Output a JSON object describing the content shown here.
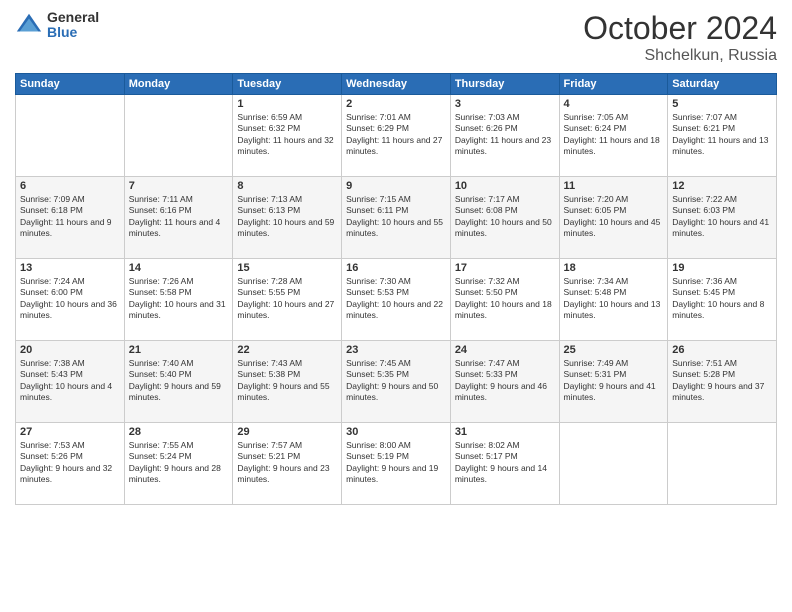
{
  "logo": {
    "general": "General",
    "blue": "Blue"
  },
  "title": {
    "month": "October 2024",
    "location": "Shchelkun, Russia"
  },
  "days_header": [
    "Sunday",
    "Monday",
    "Tuesday",
    "Wednesday",
    "Thursday",
    "Friday",
    "Saturday"
  ],
  "weeks": [
    [
      {
        "day": "",
        "sunrise": "",
        "sunset": "",
        "daylight": ""
      },
      {
        "day": "",
        "sunrise": "",
        "sunset": "",
        "daylight": ""
      },
      {
        "day": "1",
        "sunrise": "Sunrise: 6:59 AM",
        "sunset": "Sunset: 6:32 PM",
        "daylight": "Daylight: 11 hours and 32 minutes."
      },
      {
        "day": "2",
        "sunrise": "Sunrise: 7:01 AM",
        "sunset": "Sunset: 6:29 PM",
        "daylight": "Daylight: 11 hours and 27 minutes."
      },
      {
        "day": "3",
        "sunrise": "Sunrise: 7:03 AM",
        "sunset": "Sunset: 6:26 PM",
        "daylight": "Daylight: 11 hours and 23 minutes."
      },
      {
        "day": "4",
        "sunrise": "Sunrise: 7:05 AM",
        "sunset": "Sunset: 6:24 PM",
        "daylight": "Daylight: 11 hours and 18 minutes."
      },
      {
        "day": "5",
        "sunrise": "Sunrise: 7:07 AM",
        "sunset": "Sunset: 6:21 PM",
        "daylight": "Daylight: 11 hours and 13 minutes."
      }
    ],
    [
      {
        "day": "6",
        "sunrise": "Sunrise: 7:09 AM",
        "sunset": "Sunset: 6:18 PM",
        "daylight": "Daylight: 11 hours and 9 minutes."
      },
      {
        "day": "7",
        "sunrise": "Sunrise: 7:11 AM",
        "sunset": "Sunset: 6:16 PM",
        "daylight": "Daylight: 11 hours and 4 minutes."
      },
      {
        "day": "8",
        "sunrise": "Sunrise: 7:13 AM",
        "sunset": "Sunset: 6:13 PM",
        "daylight": "Daylight: 10 hours and 59 minutes."
      },
      {
        "day": "9",
        "sunrise": "Sunrise: 7:15 AM",
        "sunset": "Sunset: 6:11 PM",
        "daylight": "Daylight: 10 hours and 55 minutes."
      },
      {
        "day": "10",
        "sunrise": "Sunrise: 7:17 AM",
        "sunset": "Sunset: 6:08 PM",
        "daylight": "Daylight: 10 hours and 50 minutes."
      },
      {
        "day": "11",
        "sunrise": "Sunrise: 7:20 AM",
        "sunset": "Sunset: 6:05 PM",
        "daylight": "Daylight: 10 hours and 45 minutes."
      },
      {
        "day": "12",
        "sunrise": "Sunrise: 7:22 AM",
        "sunset": "Sunset: 6:03 PM",
        "daylight": "Daylight: 10 hours and 41 minutes."
      }
    ],
    [
      {
        "day": "13",
        "sunrise": "Sunrise: 7:24 AM",
        "sunset": "Sunset: 6:00 PM",
        "daylight": "Daylight: 10 hours and 36 minutes."
      },
      {
        "day": "14",
        "sunrise": "Sunrise: 7:26 AM",
        "sunset": "Sunset: 5:58 PM",
        "daylight": "Daylight: 10 hours and 31 minutes."
      },
      {
        "day": "15",
        "sunrise": "Sunrise: 7:28 AM",
        "sunset": "Sunset: 5:55 PM",
        "daylight": "Daylight: 10 hours and 27 minutes."
      },
      {
        "day": "16",
        "sunrise": "Sunrise: 7:30 AM",
        "sunset": "Sunset: 5:53 PM",
        "daylight": "Daylight: 10 hours and 22 minutes."
      },
      {
        "day": "17",
        "sunrise": "Sunrise: 7:32 AM",
        "sunset": "Sunset: 5:50 PM",
        "daylight": "Daylight: 10 hours and 18 minutes."
      },
      {
        "day": "18",
        "sunrise": "Sunrise: 7:34 AM",
        "sunset": "Sunset: 5:48 PM",
        "daylight": "Daylight: 10 hours and 13 minutes."
      },
      {
        "day": "19",
        "sunrise": "Sunrise: 7:36 AM",
        "sunset": "Sunset: 5:45 PM",
        "daylight": "Daylight: 10 hours and 8 minutes."
      }
    ],
    [
      {
        "day": "20",
        "sunrise": "Sunrise: 7:38 AM",
        "sunset": "Sunset: 5:43 PM",
        "daylight": "Daylight: 10 hours and 4 minutes."
      },
      {
        "day": "21",
        "sunrise": "Sunrise: 7:40 AM",
        "sunset": "Sunset: 5:40 PM",
        "daylight": "Daylight: 9 hours and 59 minutes."
      },
      {
        "day": "22",
        "sunrise": "Sunrise: 7:43 AM",
        "sunset": "Sunset: 5:38 PM",
        "daylight": "Daylight: 9 hours and 55 minutes."
      },
      {
        "day": "23",
        "sunrise": "Sunrise: 7:45 AM",
        "sunset": "Sunset: 5:35 PM",
        "daylight": "Daylight: 9 hours and 50 minutes."
      },
      {
        "day": "24",
        "sunrise": "Sunrise: 7:47 AM",
        "sunset": "Sunset: 5:33 PM",
        "daylight": "Daylight: 9 hours and 46 minutes."
      },
      {
        "day": "25",
        "sunrise": "Sunrise: 7:49 AM",
        "sunset": "Sunset: 5:31 PM",
        "daylight": "Daylight: 9 hours and 41 minutes."
      },
      {
        "day": "26",
        "sunrise": "Sunrise: 7:51 AM",
        "sunset": "Sunset: 5:28 PM",
        "daylight": "Daylight: 9 hours and 37 minutes."
      }
    ],
    [
      {
        "day": "27",
        "sunrise": "Sunrise: 7:53 AM",
        "sunset": "Sunset: 5:26 PM",
        "daylight": "Daylight: 9 hours and 32 minutes."
      },
      {
        "day": "28",
        "sunrise": "Sunrise: 7:55 AM",
        "sunset": "Sunset: 5:24 PM",
        "daylight": "Daylight: 9 hours and 28 minutes."
      },
      {
        "day": "29",
        "sunrise": "Sunrise: 7:57 AM",
        "sunset": "Sunset: 5:21 PM",
        "daylight": "Daylight: 9 hours and 23 minutes."
      },
      {
        "day": "30",
        "sunrise": "Sunrise: 8:00 AM",
        "sunset": "Sunset: 5:19 PM",
        "daylight": "Daylight: 9 hours and 19 minutes."
      },
      {
        "day": "31",
        "sunrise": "Sunrise: 8:02 AM",
        "sunset": "Sunset: 5:17 PM",
        "daylight": "Daylight: 9 hours and 14 minutes."
      },
      {
        "day": "",
        "sunrise": "",
        "sunset": "",
        "daylight": ""
      },
      {
        "day": "",
        "sunrise": "",
        "sunset": "",
        "daylight": ""
      }
    ]
  ]
}
